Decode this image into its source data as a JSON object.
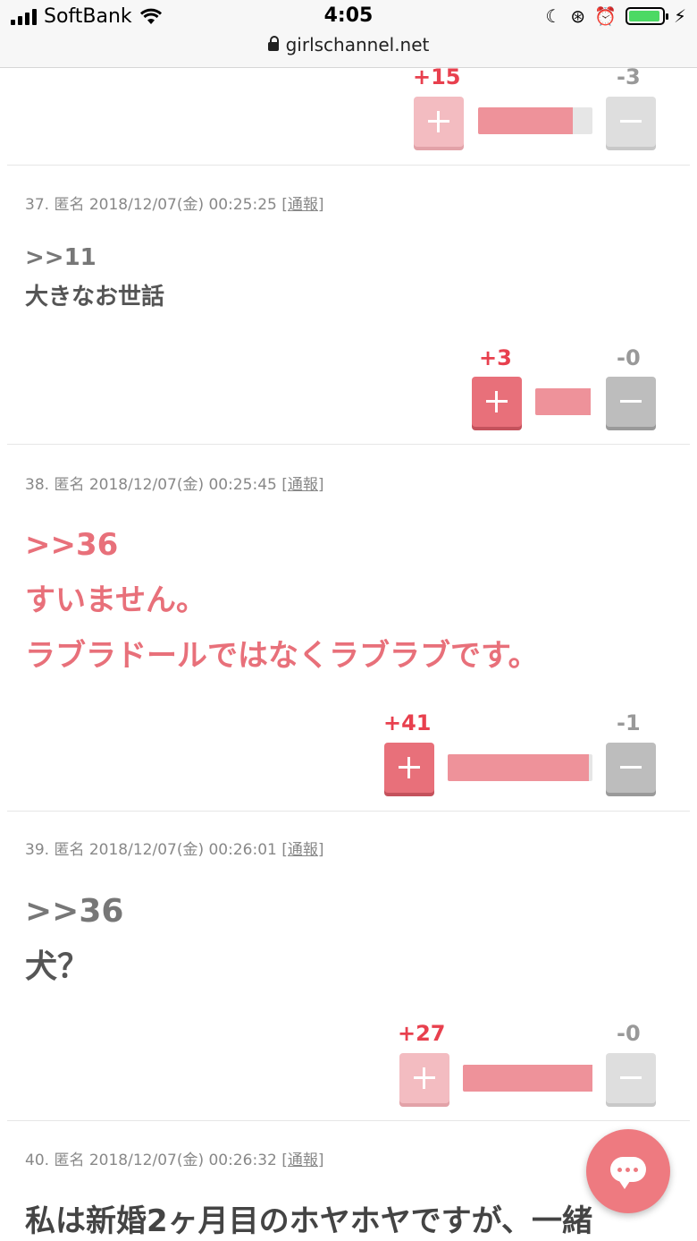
{
  "status_bar": {
    "carrier": "SoftBank",
    "time": "4:05",
    "url": "girlschannel.net",
    "battery_color": "#4cd964"
  },
  "comments": [
    {
      "id": "36-partial",
      "votes": {
        "plus": "+15",
        "minus": "-3",
        "ratio": 0.83,
        "faded": true
      }
    },
    {
      "id": "37",
      "meta": "37. 匿名 2018/12/07(金) 00:25:25 ",
      "report": "[通報]",
      "lines": [
        ">>11",
        "大きなお世話"
      ],
      "votes": {
        "plus": "+3",
        "minus": "-0",
        "ratio": 1.0,
        "faded": false
      }
    },
    {
      "id": "38",
      "meta": "38. 匿名 2018/12/07(金) 00:25:45 ",
      "report": "[通報]",
      "lines": [
        ">>36",
        "すいません。",
        "ラブラドールではなくラブラブです。"
      ],
      "votes": {
        "plus": "+41",
        "minus": "-1",
        "ratio": 0.976,
        "faded": false
      }
    },
    {
      "id": "39",
      "meta": "39. 匿名 2018/12/07(金) 00:26:01 ",
      "report": "[通報]",
      "lines": [
        ">>36",
        "犬？"
      ],
      "votes": {
        "plus": "+27",
        "minus": "-0",
        "ratio": 1.0,
        "faded": true
      }
    },
    {
      "id": "40",
      "meta": "40. 匿名 2018/12/07(金) 00:26:32 ",
      "report": "[通報]",
      "lines": [
        "私は新婚2ヶ月目のホヤホヤですが、一緒"
      ]
    }
  ],
  "colors": {
    "accent_pink": "#e8707a",
    "plus_count": "#e8404e",
    "bar_fill": "#ee929a"
  },
  "icons": {
    "chat_button": "chat-bubble-icon"
  }
}
